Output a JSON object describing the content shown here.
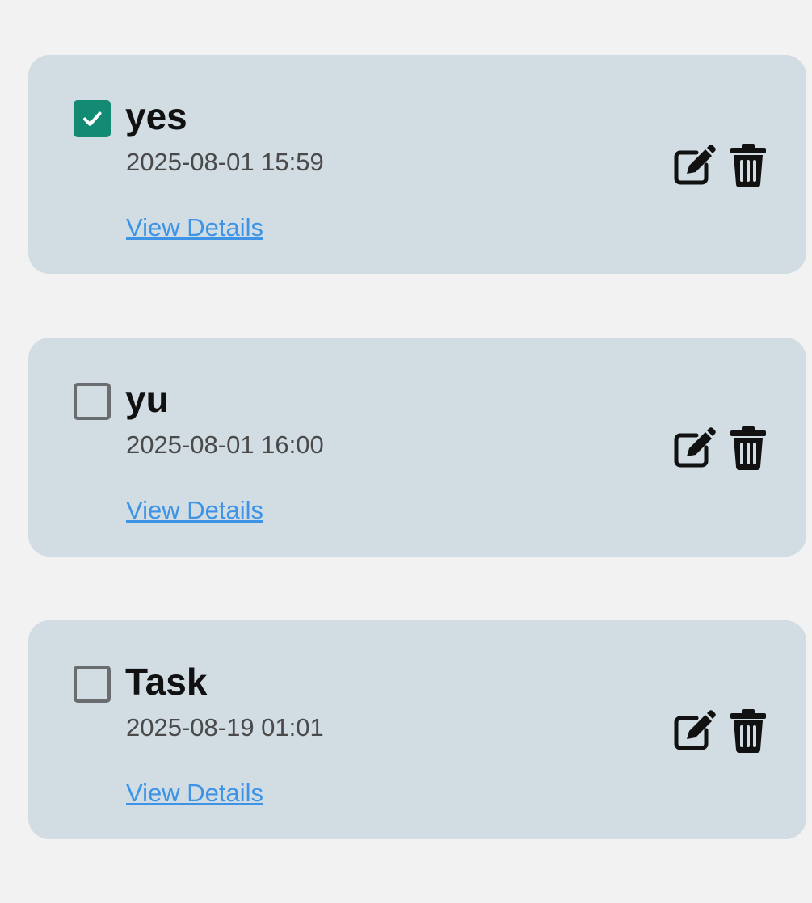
{
  "colors": {
    "background": "#f2f2f2",
    "card": "#d1dce3",
    "checked": "#138a73",
    "link": "#3d94e6",
    "unchecked_border": "#6a6d70"
  },
  "tasks": [
    {
      "title": "yes",
      "date": "2025-08-01 15:59",
      "link_label": "View Details",
      "checked": true,
      "edit_icon": "edit-icon",
      "delete_icon": "trash-icon"
    },
    {
      "title": "yu",
      "date": "2025-08-01 16:00",
      "link_label": "View Details",
      "checked": false,
      "edit_icon": "edit-icon",
      "delete_icon": "trash-icon"
    },
    {
      "title": "Task",
      "date": "2025-08-19 01:01",
      "link_label": "View Details",
      "checked": false,
      "edit_icon": "edit-icon",
      "delete_icon": "trash-icon"
    }
  ]
}
